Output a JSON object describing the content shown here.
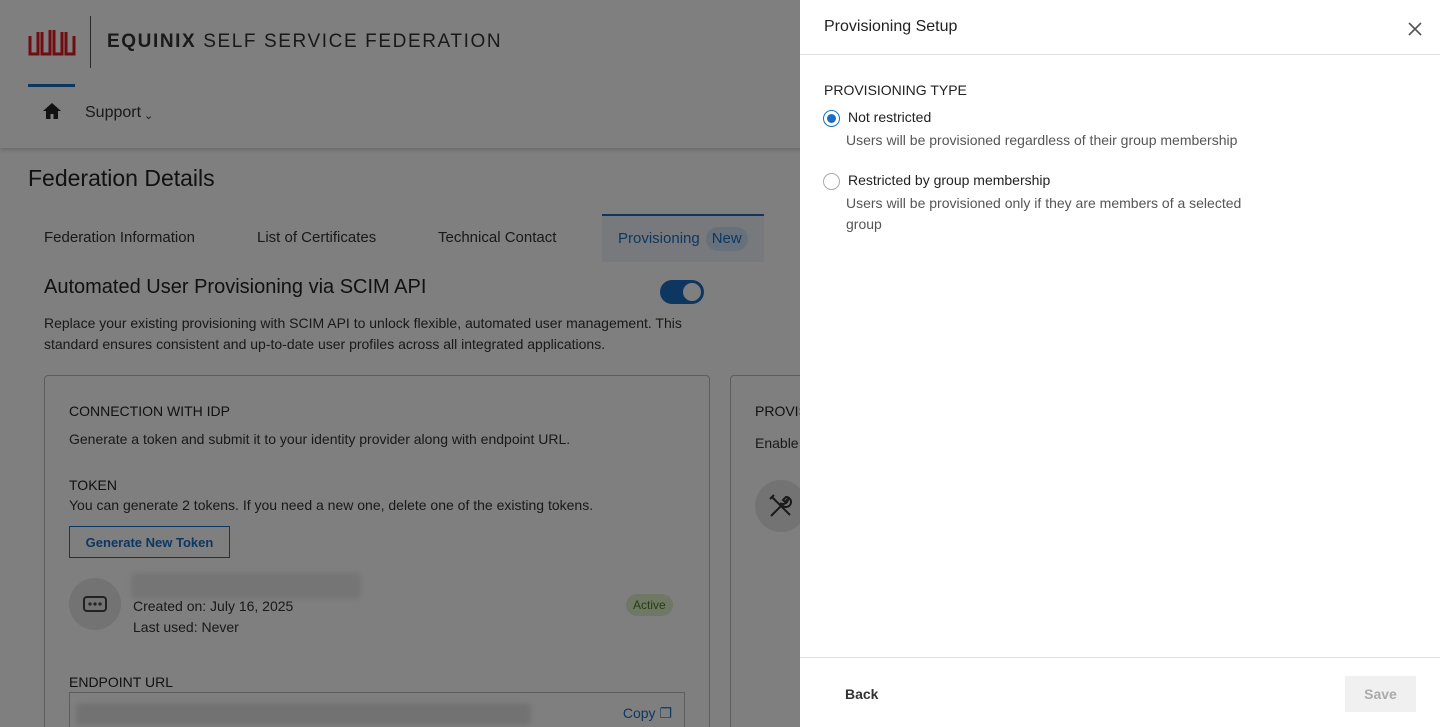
{
  "header": {
    "brand_bold": "EQUINIX",
    "brand_rest": " SELF SERVICE FEDERATION",
    "nav": {
      "support": "Support",
      "home_icon": "home-icon"
    },
    "accent_color": "#1a6fc2",
    "logo_color": "#e01a22"
  },
  "page": {
    "title": "Federation Details",
    "tabs": [
      {
        "label": "Federation Information"
      },
      {
        "label": "List of Certificates"
      },
      {
        "label": "Technical Contact"
      },
      {
        "label": "Provisioning",
        "badge": "New",
        "active": true
      }
    ],
    "scim": {
      "title": "Automated User Provisioning via SCIM API",
      "enabled": true,
      "description": "Replace your existing provisioning with SCIM API to unlock flexible, automated user management. This standard ensures consistent and up-to-date user profiles across all integrated applications."
    },
    "idp_card": {
      "heading": "CONNECTION WITH IDP",
      "description": "Generate a token and submit it to your identity provider along with endpoint URL.",
      "token_heading": "TOKEN",
      "token_description": "You can generate 2 tokens. If you need a new one, delete one of the existing tokens.",
      "generate_button": "Generate New Token",
      "token": {
        "created": "Created on: July 16, 2025",
        "last_used": "Last used: Never",
        "status": "Active"
      },
      "endpoint_heading": "ENDPOINT URL",
      "copy_label": "Copy"
    },
    "prov_card": {
      "heading": "PROVIS",
      "description": "Enable"
    }
  },
  "drawer": {
    "title": "Provisioning Setup",
    "section_label": "PROVISIONING TYPE",
    "options": [
      {
        "label": "Not restricted",
        "help": "Users will be provisioned regardless of their group membership",
        "selected": true
      },
      {
        "label": "Restricted by group membership",
        "help": "Users will be provisioned only if they are members of a selected group",
        "selected": false
      }
    ],
    "back_label": "Back",
    "save_label": "Save"
  }
}
